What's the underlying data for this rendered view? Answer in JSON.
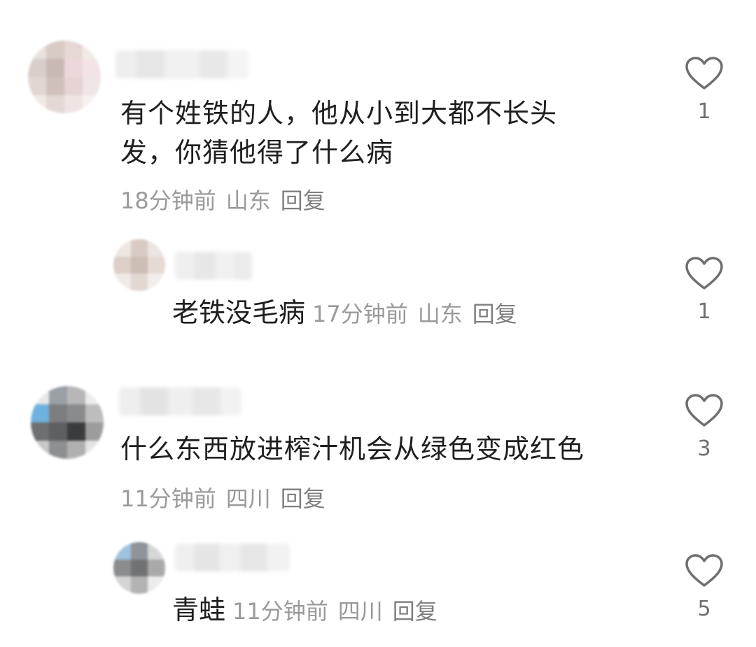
{
  "comments": [
    {
      "text": "有个姓铁的人，他从小到大都不长头发，你猜他得了什么病",
      "time": "18分钟前",
      "location": "山东",
      "reply_label": "回复",
      "likes": "1",
      "replies": [
        {
          "text": "老铁没毛病",
          "time": "17分钟前",
          "location": "山东",
          "reply_label": "回复",
          "likes": "1"
        }
      ]
    },
    {
      "text": "什么东西放进榨汁机会从绿色变成红色",
      "time": "11分钟前",
      "location": "四川",
      "reply_label": "回复",
      "likes": "3",
      "replies": [
        {
          "text": "青蛙",
          "time": "11分钟前",
          "location": "四川",
          "reply_label": "回复",
          "likes": "5"
        }
      ]
    }
  ],
  "icons": {
    "like": "heart-outline-icon"
  },
  "colors": {
    "meta_text": "#9a9a9a",
    "like_icon": "#6f6f6f"
  }
}
